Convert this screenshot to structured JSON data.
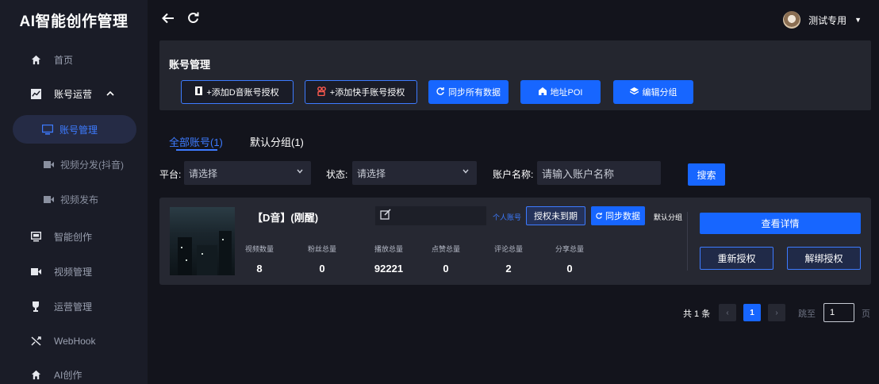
{
  "brand": "AI智能创作管理",
  "sidebar": {
    "items": [
      {
        "label": "首页",
        "icon": "home-icon"
      },
      {
        "label": "账号运营",
        "icon": "chart-icon",
        "expanded": true
      },
      {
        "label": "账号管理",
        "icon": "monitor-icon",
        "active": true
      },
      {
        "label": "视频分发(抖音)",
        "icon": "video-camera-icon"
      },
      {
        "label": "视频发布",
        "icon": "video-camera-icon"
      },
      {
        "label": "智能创作",
        "icon": "screen-icon"
      },
      {
        "label": "视频管理",
        "icon": "video-camera-icon"
      },
      {
        "label": "运营管理",
        "icon": "trophy-icon"
      },
      {
        "label": "WebHook",
        "icon": "shuffle-icon"
      },
      {
        "label": "AI创作",
        "icon": "home-icon"
      }
    ]
  },
  "topbar": {
    "user_name": "测试专用"
  },
  "account_panel": {
    "title": "账号管理",
    "buttons": {
      "add_douyin": "+添加D音账号授权",
      "add_kuaishou": "+添加快手账号授权",
      "sync_all": "同步所有数据",
      "poi": "地址POI",
      "edit_group": "编辑分组"
    }
  },
  "tabs": {
    "all": "全部账号(1)",
    "default": "默认分组(1)"
  },
  "filters": {
    "platform_label": "平台:",
    "platform_value": "请选择",
    "status_label": "状态:",
    "status_value": "请选择",
    "name_label": "账户名称:",
    "name_placeholder": "请输入账户名称",
    "search": "搜索"
  },
  "account_card": {
    "name": "【D音】(刚醒)",
    "personal_tag": "个人账号",
    "auth_status": "授权未到期",
    "sync_label": "同步数据",
    "group_label": "默认分组",
    "stats": [
      {
        "label": "视频数量",
        "value": "8"
      },
      {
        "label": "粉丝总量",
        "value": "0"
      },
      {
        "label": "播放总量",
        "value": "92221"
      },
      {
        "label": "点赞总量",
        "value": "0"
      },
      {
        "label": "评论总量",
        "value": "2"
      },
      {
        "label": "分享总量",
        "value": "0"
      }
    ],
    "detail_button": "查看详情",
    "reauth_button": "重新授权",
    "unbind_button": "解绑授权"
  },
  "pagination": {
    "total": "共 1 条",
    "current_page": "1",
    "goto_label": "跳至",
    "goto_value": "1",
    "page_suffix": "页"
  },
  "colors": {
    "accent": "#1766ff",
    "sidebar_bg": "#1a1c27",
    "page_bg": "#13141c",
    "card_bg": "#262832"
  }
}
